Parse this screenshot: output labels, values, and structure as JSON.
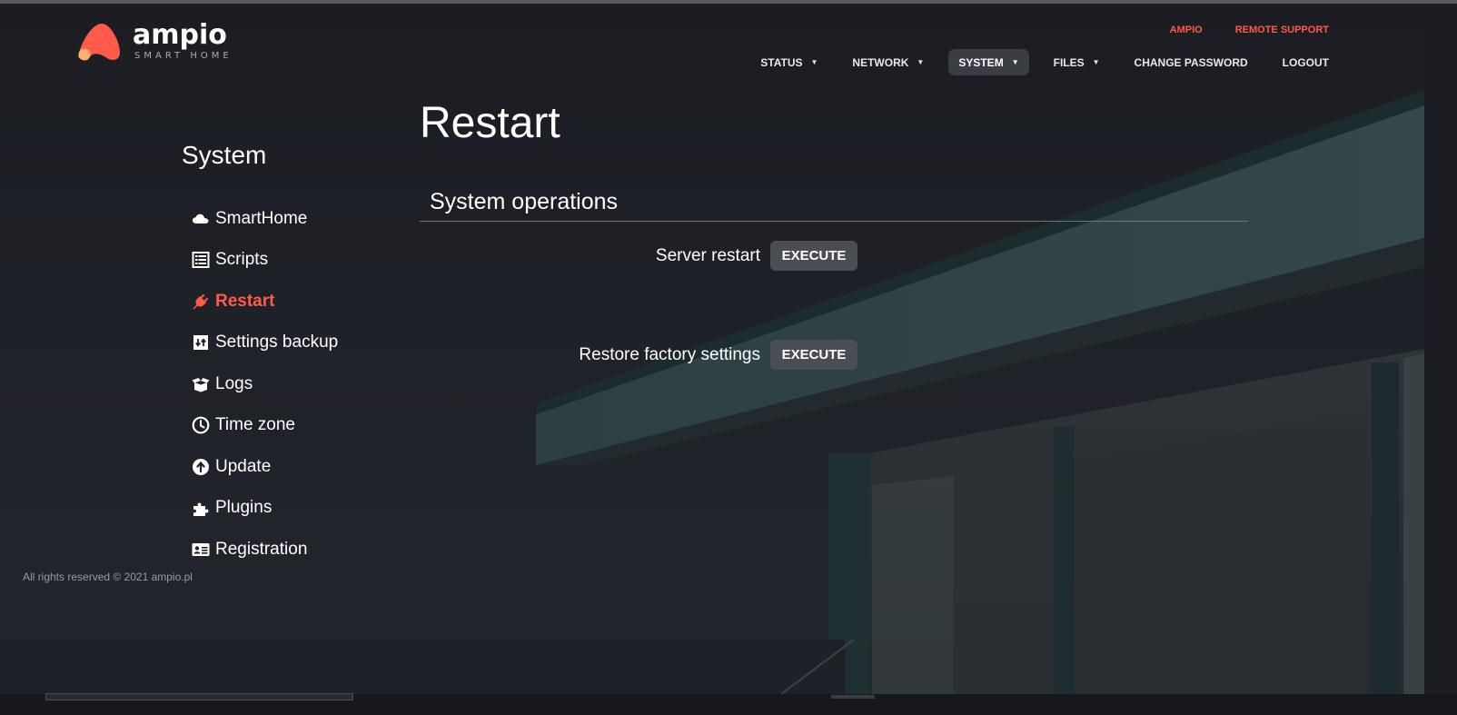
{
  "brand": {
    "name": "ampio",
    "tagline": "SMART HOME",
    "accent": "#ff5a4a"
  },
  "top_links": [
    {
      "label": "AMPIO"
    },
    {
      "label": "REMOTE SUPPORT"
    }
  ],
  "nav": {
    "status": "STATUS",
    "network": "NETWORK",
    "system": "SYSTEM",
    "files": "FILES",
    "change_password": "CHANGE PASSWORD",
    "logout": "LOGOUT",
    "caret": "▼"
  },
  "sidebar": {
    "title": "System",
    "items": [
      {
        "label": "SmartHome",
        "icon": "cloud-icon"
      },
      {
        "label": "Scripts",
        "icon": "list-icon"
      },
      {
        "label": "Restart",
        "icon": "plug-icon",
        "active": true
      },
      {
        "label": "Settings backup",
        "icon": "backup-icon"
      },
      {
        "label": "Logs",
        "icon": "box-icon"
      },
      {
        "label": "Time zone",
        "icon": "clock-icon"
      },
      {
        "label": "Update",
        "icon": "upload-circle-icon"
      },
      {
        "label": "Plugins",
        "icon": "puzzle-icon"
      },
      {
        "label": "Registration",
        "icon": "id-card-icon"
      }
    ]
  },
  "main": {
    "title": "Restart",
    "section_title": "System operations",
    "operations": [
      {
        "label": "Server restart",
        "button": "EXECUTE"
      },
      {
        "label": "Restore factory settings",
        "button": "EXECUTE"
      }
    ]
  },
  "footer": {
    "text": "All rights reserved © 2021 ampio.pl"
  }
}
